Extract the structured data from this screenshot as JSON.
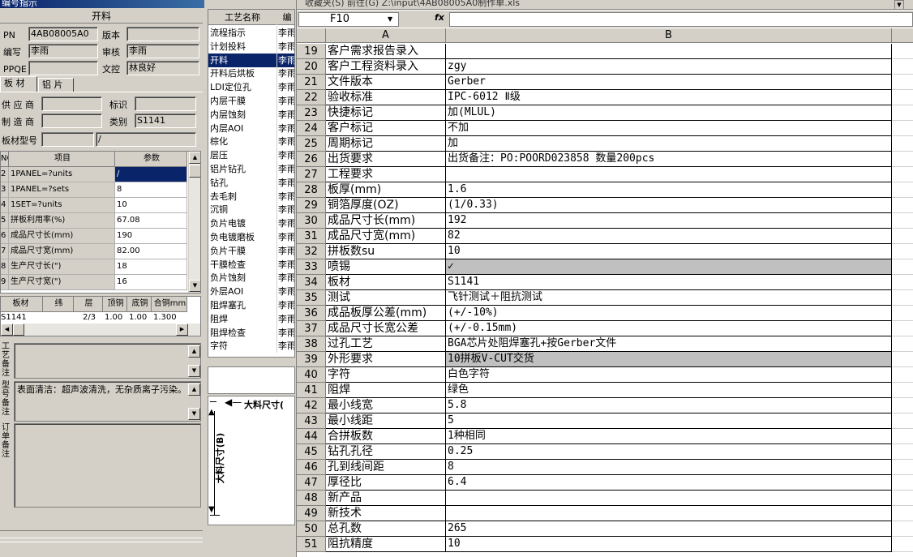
{
  "window": {
    "title": "编号指示"
  },
  "form": {
    "section_title": "开料",
    "pn_label": "PN",
    "pn_value": "4AB08005A0",
    "version_label": "版本",
    "version_value": "",
    "editor_label": "编写",
    "editor_value": "李雨",
    "reviewer_label": "审核",
    "reviewer_value": "李雨",
    "ppqe_label": "PPQE",
    "ppqe_value": "",
    "doc_control_label": "文控",
    "doc_control_value": "林良好",
    "tabs": [
      "板 材",
      "铝 片"
    ],
    "supplier_label": "供 应 商",
    "supplier_value": "",
    "mark_label": "标识",
    "mark_value": "",
    "manufacturer_label": "制 造 商",
    "manufacturer_value": "",
    "category_label": "类别",
    "category_value": "S1141",
    "board_model_label": "板材型号",
    "board_model_value": "",
    "board_model_value2": "/"
  },
  "params_table": {
    "headers": [
      "NO",
      "项目",
      "参数"
    ],
    "rows": [
      {
        "no": "2",
        "item": "1PANEL=?units",
        "value": "/"
      },
      {
        "no": "3",
        "item": "1PANEL=?sets",
        "value": "8"
      },
      {
        "no": "4",
        "item": "1SET=?units",
        "value": "10"
      },
      {
        "no": "5",
        "item": "拼板利用率(%)",
        "value": "67.08"
      },
      {
        "no": "6",
        "item": "成品尺寸长(mm)",
        "value": "190"
      },
      {
        "no": "7",
        "item": "成品尺寸宽(mm)",
        "value": "82.00"
      },
      {
        "no": "8",
        "item": "生产尺寸长(\")",
        "value": "18"
      },
      {
        "no": "9",
        "item": "生产尺寸宽(\")",
        "value": "16"
      }
    ]
  },
  "board_table": {
    "headers": [
      "板材",
      "纬",
      "层",
      "顶铜",
      "底铜",
      "合铜mm"
    ],
    "row": {
      "board": "S1141",
      "weft": "",
      "layer": "2/3",
      "top_cu": "1.00",
      "bottom_cu": "1.00",
      "total_cu": "1.300"
    }
  },
  "memos": {
    "process_note_label": "工艺备注",
    "process_note_value": "",
    "type_note_label": "型号备注",
    "type_note_value": "表面清洁：超声波清洗，无杂质离子污染。",
    "order_note_label": "订单备注",
    "order_note_value": ""
  },
  "process_list": {
    "headers": [
      "工艺名称",
      "编"
    ],
    "items": [
      {
        "name": "流程指示",
        "editor": "李雨"
      },
      {
        "name": "计划投料",
        "editor": "李雨"
      },
      {
        "name": "开料",
        "editor": "李雨"
      },
      {
        "name": "开料后烘板",
        "editor": "李雨"
      },
      {
        "name": "LDI定位孔",
        "editor": "李雨"
      },
      {
        "name": "内层干膜",
        "editor": "李雨"
      },
      {
        "name": "内层蚀刻",
        "editor": "李雨"
      },
      {
        "name": "内层AOI",
        "editor": "李雨"
      },
      {
        "name": "棕化",
        "editor": "李雨"
      },
      {
        "name": "层压",
        "editor": "李雨"
      },
      {
        "name": "铝片钻孔",
        "editor": "李雨"
      },
      {
        "name": "钻孔",
        "editor": "李雨"
      },
      {
        "name": "去毛刺",
        "editor": "李雨"
      },
      {
        "name": "沉铜",
        "editor": "李雨"
      },
      {
        "name": "负片电镀",
        "editor": "李雨"
      },
      {
        "name": "负电镀磨板",
        "editor": "李雨"
      },
      {
        "name": "负片干膜",
        "editor": "李雨"
      },
      {
        "name": "干膜检查",
        "editor": "李雨"
      },
      {
        "name": "负片蚀刻",
        "editor": "李雨"
      },
      {
        "name": "外层AOI",
        "editor": "李雨"
      },
      {
        "name": "阻焊塞孔",
        "editor": "李雨"
      },
      {
        "name": "阻焊",
        "editor": "李雨"
      },
      {
        "name": "阻焊检查",
        "editor": "李雨"
      },
      {
        "name": "字符",
        "editor": "李雨"
      }
    ]
  },
  "diagram": {
    "length_label": "大料尺寸(",
    "width_label": "大料尺寸(B)"
  },
  "spreadsheet": {
    "toolbar_text": "收藏夹(S)  前往(G)   Z:\\input\\4AB08005A0制作单.xls",
    "name_box": "F10",
    "fx": "fx",
    "columns": [
      "A",
      "B"
    ],
    "rows": [
      {
        "n": "19",
        "a": "客户需求报告录入",
        "b": ""
      },
      {
        "n": "20",
        "a": "客户工程资料录入",
        "b": "zgy"
      },
      {
        "n": "21",
        "a": "文件版本",
        "b": "Gerber"
      },
      {
        "n": "22",
        "a": "验收标准",
        "b": "IPC-6012 Ⅱ级"
      },
      {
        "n": "23",
        "a": "快捷标记",
        "b": "加(MLUL)"
      },
      {
        "n": "24",
        "a": "客户标记",
        "b": "不加"
      },
      {
        "n": "25",
        "a": "周期标记",
        "b": "加"
      },
      {
        "n": "26",
        "a": "出货要求",
        "b": "出货备注：PO:POORD023858 数量200pcs"
      },
      {
        "n": "27",
        "a": "工程要求",
        "b": ""
      },
      {
        "n": "28",
        "a": "板厚(mm)",
        "b": "1.6"
      },
      {
        "n": "29",
        "a": "铜箔厚度(OZ)",
        "b": "(1/0.33)"
      },
      {
        "n": "30",
        "a": "成品尺寸长(mm)",
        "b": "192"
      },
      {
        "n": "31",
        "a": "成品尺寸宽(mm)",
        "b": "82"
      },
      {
        "n": "32",
        "a": "拼板数su",
        "b": "10"
      },
      {
        "n": "33",
        "a": "喷锡",
        "b": "✓",
        "highlight": true
      },
      {
        "n": "34",
        "a": "板材",
        "b": "S1141"
      },
      {
        "n": "35",
        "a": "测试",
        "b": "飞针测试＋阻抗测试"
      },
      {
        "n": "36",
        "a": "成品板厚公差(mm)",
        "b": "(+/-10%)"
      },
      {
        "n": "37",
        "a": "成品尺寸长宽公差",
        "b": "(+/-0.15mm)"
      },
      {
        "n": "38",
        "a": "过孔工艺",
        "b": "BGA芯片处阻焊塞孔+按Gerber文件"
      },
      {
        "n": "39",
        "a": "外形要求",
        "b": "10拼板V-CUT交货",
        "highlight": true
      },
      {
        "n": "40",
        "a": "字符",
        "b": "白色字符"
      },
      {
        "n": "41",
        "a": "阻焊",
        "b": "绿色"
      },
      {
        "n": "42",
        "a": "最小线宽",
        "b": "5.8"
      },
      {
        "n": "43",
        "a": "最小线距",
        "b": "5"
      },
      {
        "n": "44",
        "a": "合拼板数",
        "b": "1种相同"
      },
      {
        "n": "45",
        "a": "钻孔孔径",
        "b": "0.25"
      },
      {
        "n": "46",
        "a": "孔到线间距",
        "b": "8"
      },
      {
        "n": "47",
        "a": "厚径比",
        "b": "6.4"
      },
      {
        "n": "48",
        "a": "新产品",
        "b": ""
      },
      {
        "n": "49",
        "a": "新技术",
        "b": ""
      },
      {
        "n": "50",
        "a": "总孔数",
        "b": "265"
      },
      {
        "n": "51",
        "a": "阻抗精度",
        "b": "10"
      }
    ]
  }
}
